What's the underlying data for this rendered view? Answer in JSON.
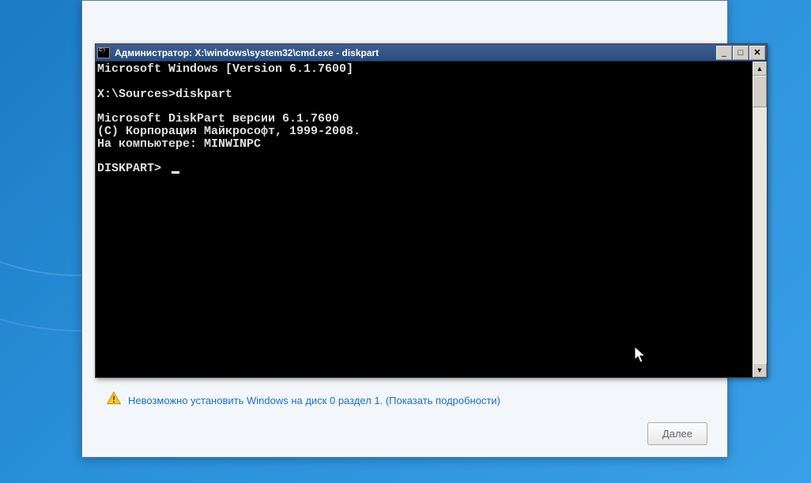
{
  "installer": {
    "warning_text": "Невозможно установить Windows на диск 0 раздел 1. (Показать подробности)",
    "next_label": "Далее",
    "next_accel": "Д",
    "next_rest": "алее"
  },
  "cmd": {
    "title": "Администратор: X:\\windows\\system32\\cmd.exe - diskpart",
    "lines": {
      "l1": "Microsoft Windows [Version 6.1.7600]",
      "l2": "",
      "l3": "X:\\Sources>diskpart",
      "l4": "",
      "l5": "Microsoft DiskPart версии 6.1.7600",
      "l6": "(C) Корпорация Майкрософт, 1999-2008.",
      "l7": "На компьютере: MINWINPC",
      "l8": "",
      "l9": "DISKPART> "
    },
    "controls": {
      "minimize": "_",
      "maximize": "□",
      "close": "✕"
    },
    "scroll": {
      "up": "▲",
      "down": "▼"
    }
  }
}
